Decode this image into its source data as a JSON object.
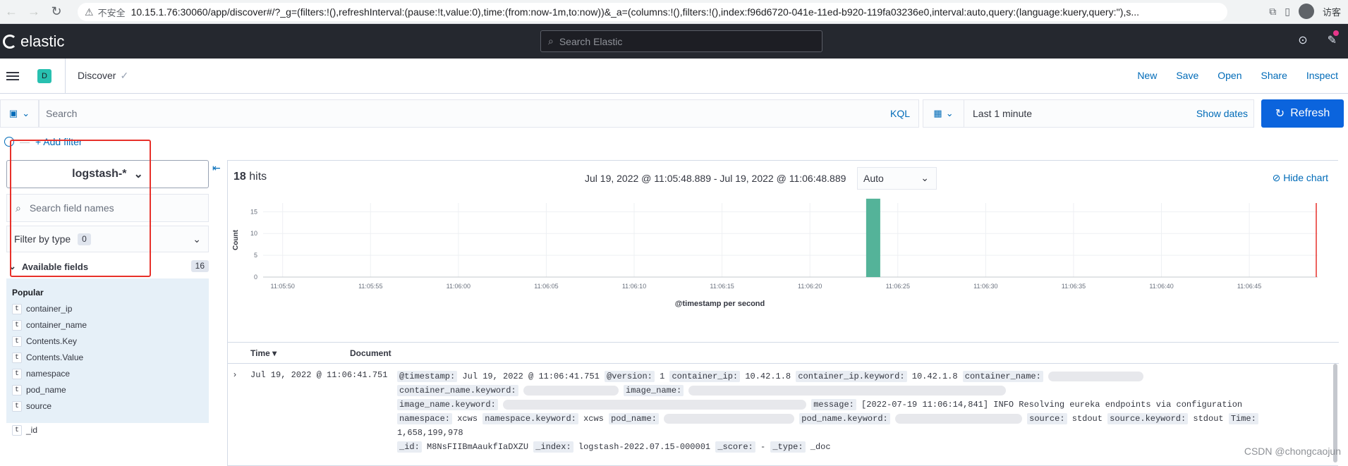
{
  "browser": {
    "insecure_label": "不安全",
    "url": "10.15.1.76:30060/app/discover#/?_g=(filters:!(),refreshInterval:(pause:!t,value:0),time:(from:now-1m,to:now))&_a=(columns:!(),filters:!(),index:f96d6720-041e-11ed-b920-119fa03236e0,interval:auto,query:(language:kuery,query:''),s...",
    "guest_label": "访客"
  },
  "header": {
    "logo_text": "elastic",
    "search_placeholder": "Search Elastic"
  },
  "appbar": {
    "space_initial": "D",
    "breadcrumb": "Discover",
    "links": [
      "New",
      "Save",
      "Open",
      "Share",
      "Inspect"
    ]
  },
  "query": {
    "placeholder": "Search",
    "language": "KQL",
    "date_range": "Last 1 minute",
    "show_dates": "Show dates",
    "refresh": "Refresh",
    "add_filter": "+ Add filter"
  },
  "sidebar": {
    "index_pattern": "logstash-*",
    "field_search_placeholder": "Search field names",
    "filter_by_type": "Filter by type",
    "filter_count": "0",
    "available_fields": "Available fields",
    "available_count": "16",
    "popular_label": "Popular",
    "popular_fields": [
      "container_ip",
      "container_name",
      "Contents.Key",
      "Contents.Value",
      "namespace",
      "pod_name",
      "source"
    ],
    "other_fields": [
      "_id"
    ],
    "field_type_glyph": "t"
  },
  "results": {
    "hits_count": "18",
    "hits_label": "hits",
    "time_range": "Jul 19, 2022 @ 11:05:48.889 - Jul 19, 2022 @ 11:06:48.889",
    "interval": "Auto",
    "hide_chart": "Hide chart",
    "col_time": "Time",
    "col_document": "Document",
    "row_time": "Jul 19, 2022 @ 11:06:41.751",
    "doc": {
      "timestamp_k": "@timestamp:",
      "timestamp_v": "Jul 19, 2022 @ 11:06:41.751",
      "version_k": "@version:",
      "version_v": "1",
      "cip_k": "container_ip:",
      "cip_v": "10.42.1.8",
      "cipk_k": "container_ip.keyword:",
      "cipk_v": "10.42.1.8",
      "cname_k": "container_name:",
      "cnamek_k": "container_name.keyword:",
      "img_k": "image_name:",
      "imgk_k": "image_name.keyword:",
      "msg_k": "message:",
      "msg_v": "[2022-07-19 11:06:14,841] INFO Resolving eureka endpoints via configuration",
      "ns_k": "namespace:",
      "ns_v": "xcws",
      "nsk_k": "namespace.keyword:",
      "nsk_v": "xcws",
      "pod_k": "pod_name:",
      "podk_k": "pod_name.keyword:",
      "src_k": "source:",
      "src_v": "stdout",
      "srck_k": "source.keyword:",
      "srck_v": "stdout",
      "time_k": "Time:",
      "time_v": "1,658,199,978",
      "id_k": "_id:",
      "id_v": "M8NsFIIBmAaukfIaDXZU",
      "index_k": "_index:",
      "index_v": "logstash-2022.07.15-000001",
      "score_k": "_score:",
      "score_v": "-",
      "type_k": "_type:",
      "type_v": "_doc"
    }
  },
  "chart_data": {
    "type": "bar",
    "xlabel": "@timestamp per second",
    "ylabel": "Count",
    "ylim": [
      0,
      17
    ],
    "yticks": [
      0,
      5,
      10,
      15
    ],
    "xticks": [
      "11:05:50",
      "11:05:55",
      "11:06:00",
      "11:06:05",
      "11:06:10",
      "11:06:15",
      "11:06:20",
      "11:06:25",
      "11:06:30",
      "11:06:35",
      "11:06:40",
      "11:06:45"
    ],
    "bars": [
      {
        "t": 41,
        "value": 18
      }
    ],
    "bar_color": "#54b399",
    "now_marker_color": "#e7302a"
  },
  "watermark": "CSDN @chongcaojun"
}
